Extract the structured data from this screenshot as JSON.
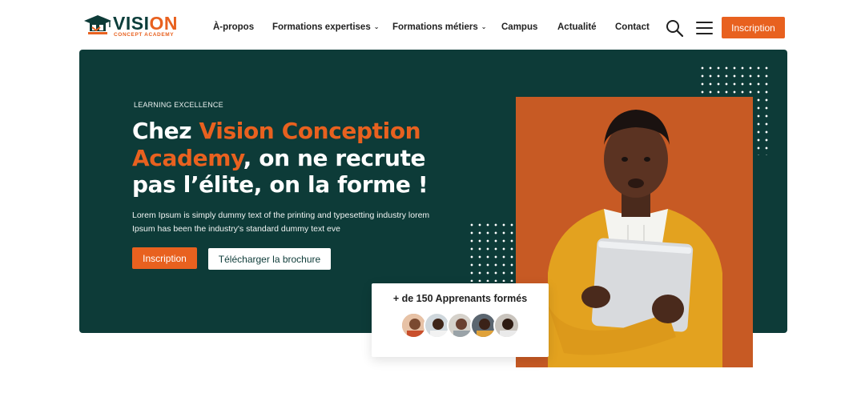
{
  "brand": {
    "word_green": "VISI",
    "word_orange": "ON",
    "sub_concept": "CONCEPT",
    "sub_academy": "ACADEMY",
    "colors": {
      "primary": "#0d3b38",
      "accent": "#e8611f"
    }
  },
  "nav": {
    "items": [
      {
        "label": "À-propos",
        "dropdown": false
      },
      {
        "label": "Formations expertises",
        "dropdown": true
      },
      {
        "label": "Formations métiers",
        "dropdown": true
      },
      {
        "label": "Campus",
        "dropdown": false
      },
      {
        "label": "Actualité",
        "dropdown": false
      },
      {
        "label": "Contact",
        "dropdown": false
      }
    ],
    "chevron": "⌄",
    "search_icon": "search-icon",
    "menu_icon": "hamburger-icon",
    "cta_label": "Inscription"
  },
  "hero": {
    "eyebrow": "LEARNING EXCELLENCE",
    "headline_part1": "Chez ",
    "headline_accent": "Vision Conception Academy",
    "headline_part2": ", on ne recrute pas l’élite, on la forme !",
    "description": "Lorem Ipsum is simply dummy text of the printing and typesetting industry lorem Ipsum has been the industry's standard dummy text eve",
    "primary_button": "Inscription",
    "secondary_button": "Télécharger la brochure"
  },
  "stats": {
    "text": "+ de 150 Apprenants formés"
  }
}
